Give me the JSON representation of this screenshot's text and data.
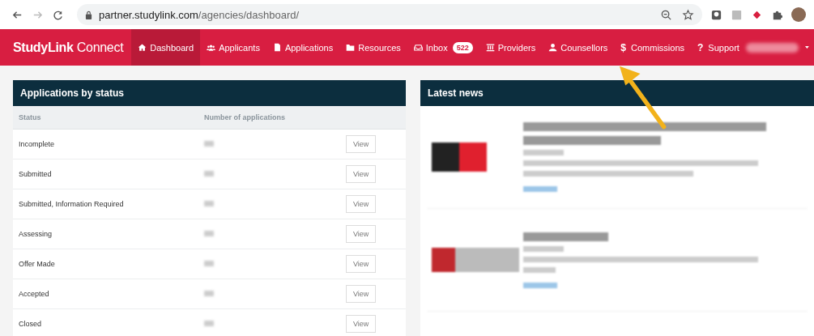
{
  "browser": {
    "url_host": "partner.studylink.com",
    "url_path": "/agencies/dashboard/"
  },
  "nav": {
    "logo_main": "StudyLink",
    "logo_sub": "Connect",
    "items": [
      {
        "kind": "home",
        "label": "Dashboard",
        "selected": true
      },
      {
        "kind": "people",
        "label": "Applicants",
        "selected": false
      },
      {
        "kind": "file",
        "label": "Applications",
        "selected": false
      },
      {
        "kind": "folder",
        "label": "Resources",
        "selected": false
      },
      {
        "kind": "inbox",
        "label": "Inbox",
        "badge": "522",
        "selected": false
      },
      {
        "kind": "bank",
        "label": "Providers",
        "selected": false
      },
      {
        "kind": "person",
        "label": "Counsellors",
        "selected": false
      },
      {
        "kind": "glyph",
        "glyph": "$",
        "label": "Commissions",
        "selected": false
      },
      {
        "kind": "glyph",
        "glyph": "?",
        "label": "Support",
        "selected": false
      }
    ]
  },
  "status_panel": {
    "title": "Applications by status",
    "columns": [
      "Status",
      "Number of applications"
    ],
    "rows": [
      {
        "status": "Incomplete",
        "button": "View"
      },
      {
        "status": "Submitted",
        "button": "View"
      },
      {
        "status": "Submitted, Information Required",
        "button": "View"
      },
      {
        "status": "Assessing",
        "button": "View"
      },
      {
        "status": "Offer Made",
        "button": "View"
      },
      {
        "status": "Accepted",
        "button": "View"
      },
      {
        "status": "Closed",
        "button": "View"
      }
    ]
  },
  "news_panel": {
    "title": "Latest news"
  }
}
